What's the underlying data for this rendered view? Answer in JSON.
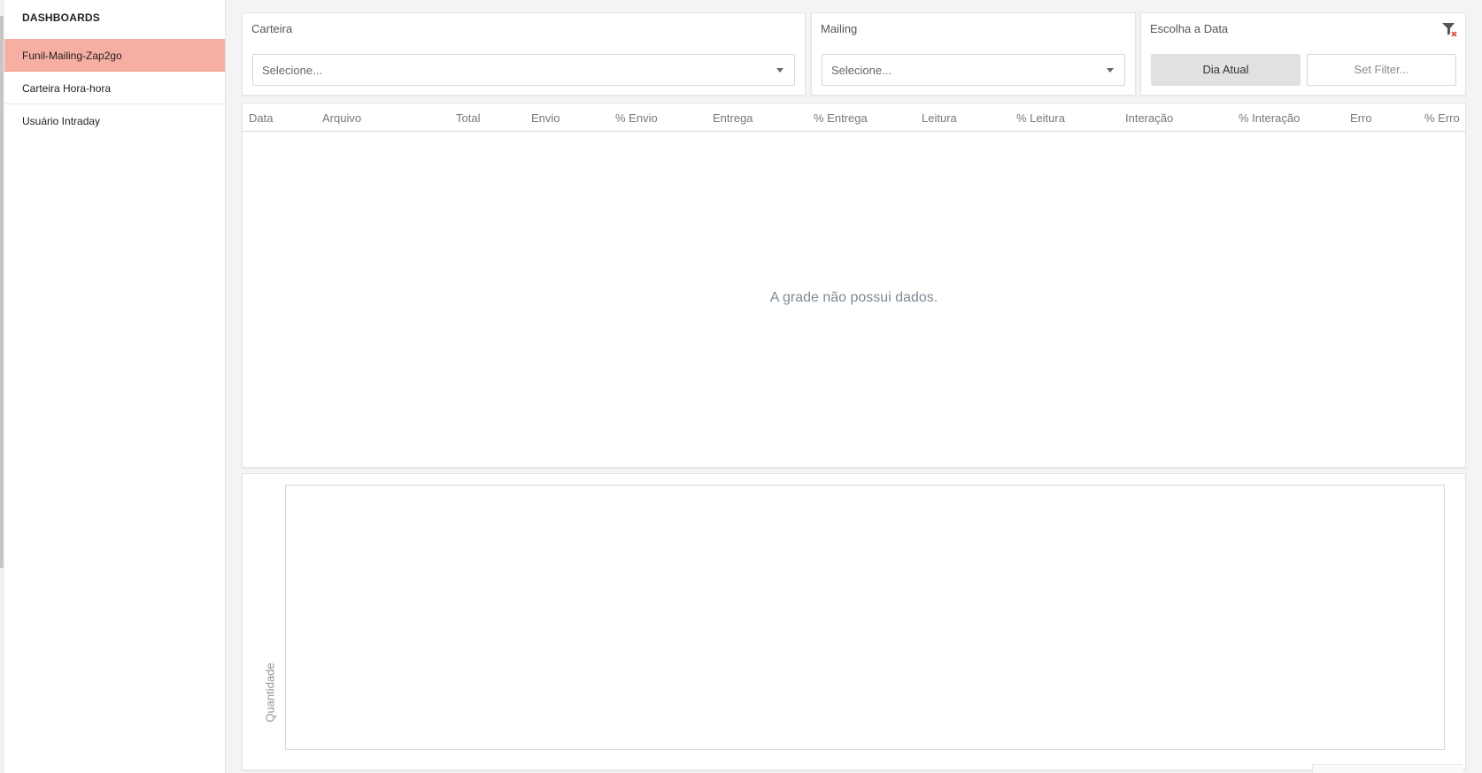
{
  "sidebar": {
    "title": "DASHBOARDS",
    "items": [
      {
        "label": "Funil-Mailing-Zap2go",
        "active": true
      },
      {
        "label": "Carteira Hora-hora",
        "active": false
      },
      {
        "label": "Usuário Intraday",
        "active": false
      }
    ],
    "active_color": "#f7aea3"
  },
  "filters": {
    "carteira": {
      "caption": "Carteira",
      "placeholder": "Selecione..."
    },
    "mailing": {
      "caption": "Mailing",
      "placeholder": "Selecione..."
    },
    "date": {
      "caption": "Escolha a Data",
      "primary_button": "Dia Atual",
      "secondary_button": "Set Filter...",
      "clear_icon": "filter-clear-icon"
    }
  },
  "grid": {
    "columns": [
      "Data",
      "Arquivo",
      "Total",
      "Envio",
      "% Envio",
      "Entrega",
      "% Entrega",
      "Leitura",
      "% Leitura",
      "Interação",
      "% Interação",
      "Erro",
      "% Erro"
    ],
    "empty_message": "A grade não possui dados."
  },
  "chart": {
    "ylabel": "Quantidade"
  }
}
